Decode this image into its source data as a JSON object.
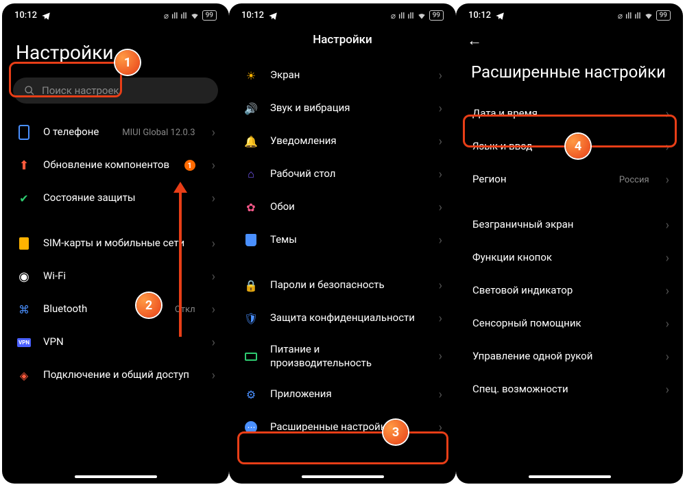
{
  "status": {
    "time": "10:12",
    "battery": "99"
  },
  "callouts": {
    "c1": "1",
    "c2": "2",
    "c3": "3",
    "c4": "4"
  },
  "p1": {
    "title": "Настройки",
    "search_placeholder": "Поиск настроек",
    "items": {
      "about": {
        "label": "О телефоне",
        "sub": "MIUI Global 12.0.3"
      },
      "update": {
        "label": "Обновление компонентов",
        "badge": "1"
      },
      "security": {
        "label": "Состояние защиты"
      },
      "sim": {
        "label": "SIM-карты и мобильные сети"
      },
      "wifi": {
        "label": "Wi-Fi"
      },
      "bt": {
        "label": "Bluetooth",
        "sub": "Откл"
      },
      "vpn": {
        "label": "VPN"
      },
      "connect": {
        "label": "Подключение и общий доступ"
      }
    }
  },
  "p2": {
    "title": "Настройки",
    "items": {
      "screen": {
        "label": "Экран"
      },
      "sound": {
        "label": "Звук и вибрация"
      },
      "notif": {
        "label": "Уведомления"
      },
      "desktop": {
        "label": "Рабочий стол"
      },
      "wall": {
        "label": "Обои"
      },
      "themes": {
        "label": "Темы"
      },
      "pass": {
        "label": "Пароли и безопасность"
      },
      "privacy": {
        "label": "Защита конфиденциальности"
      },
      "power": {
        "label": "Питание и производительность"
      },
      "apps": {
        "label": "Приложения"
      },
      "ext": {
        "label": "Расширенные настройки"
      }
    }
  },
  "p3": {
    "title": "Расширенные настройки",
    "items": {
      "date": {
        "label": "Дата и время"
      },
      "lang": {
        "label": "Язык и ввод"
      },
      "region": {
        "label": "Регион",
        "sub": "Россия"
      },
      "edge": {
        "label": "Безграничный экран"
      },
      "buttons": {
        "label": "Функции кнопок"
      },
      "led": {
        "label": "Световой индикатор"
      },
      "touch": {
        "label": "Сенсорный помощник"
      },
      "onehand": {
        "label": "Управление одной рукой"
      },
      "access": {
        "label": "Спец. возможности"
      }
    }
  }
}
